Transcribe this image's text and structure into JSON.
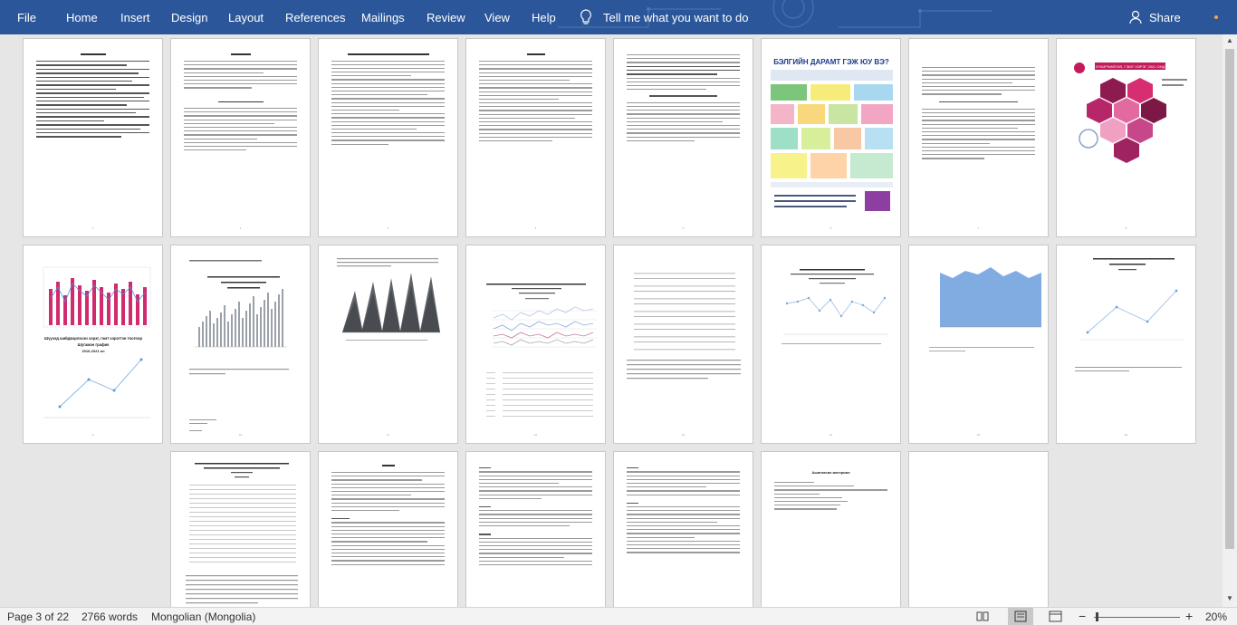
{
  "ribbon": {
    "tabs": [
      "File",
      "Home",
      "Insert",
      "Design",
      "Layout",
      "References",
      "Mailings",
      "Review",
      "View",
      "Help"
    ],
    "tell_me": "Tell me what you want to do",
    "share": "Share"
  },
  "document": {
    "page4_infographic_title": "БЭЛГИЙН ДАРАМТ ГЭЖ ЮУ ВЭ?",
    "page8_banner": "ХҮЧИРХИЙЛЭЛ, ГЭМТ ХЭРЭГ 2021 ОНД",
    "page10_title": "Шүүхэд шийдвэрлэсэн хэрэг, гэмт хэрэгтэн тоогоор",
    "page10_subtitle": "Шугаман график",
    "page10_years": "2016-2021 он",
    "page20_title": "Ашигласан материал"
  },
  "status": {
    "page": "Page 3 of 22",
    "words": "2766 words",
    "language": "Mongolian (Mongolia)",
    "zoom": "20%",
    "minus": "−",
    "plus": "+"
  }
}
